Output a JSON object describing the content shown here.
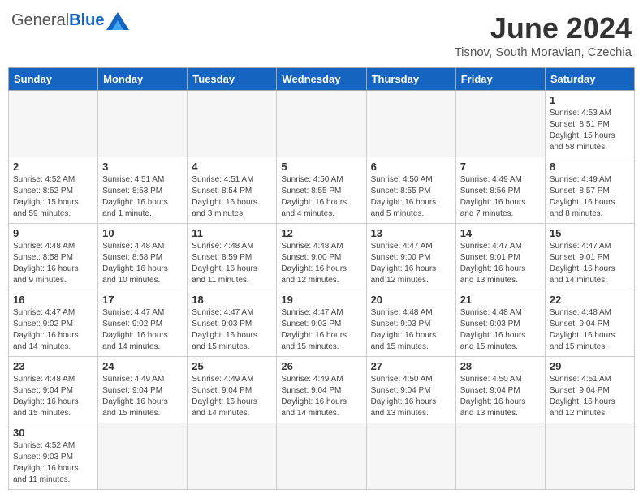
{
  "header": {
    "logo_general": "General",
    "logo_blue": "Blue",
    "month_title": "June 2024",
    "location": "Tisnov, South Moravian, Czechia"
  },
  "days_of_week": [
    "Sunday",
    "Monday",
    "Tuesday",
    "Wednesday",
    "Thursday",
    "Friday",
    "Saturday"
  ],
  "weeks": [
    [
      {
        "day": "",
        "info": ""
      },
      {
        "day": "",
        "info": ""
      },
      {
        "day": "",
        "info": ""
      },
      {
        "day": "",
        "info": ""
      },
      {
        "day": "",
        "info": ""
      },
      {
        "day": "",
        "info": ""
      },
      {
        "day": "1",
        "info": "Sunrise: 4:53 AM\nSunset: 8:51 PM\nDaylight: 15 hours\nand 58 minutes."
      }
    ],
    [
      {
        "day": "2",
        "info": "Sunrise: 4:52 AM\nSunset: 8:52 PM\nDaylight: 15 hours\nand 59 minutes."
      },
      {
        "day": "3",
        "info": "Sunrise: 4:51 AM\nSunset: 8:53 PM\nDaylight: 16 hours\nand 1 minute."
      },
      {
        "day": "4",
        "info": "Sunrise: 4:51 AM\nSunset: 8:54 PM\nDaylight: 16 hours\nand 3 minutes."
      },
      {
        "day": "5",
        "info": "Sunrise: 4:50 AM\nSunset: 8:55 PM\nDaylight: 16 hours\nand 4 minutes."
      },
      {
        "day": "6",
        "info": "Sunrise: 4:50 AM\nSunset: 8:55 PM\nDaylight: 16 hours\nand 5 minutes."
      },
      {
        "day": "7",
        "info": "Sunrise: 4:49 AM\nSunset: 8:56 PM\nDaylight: 16 hours\nand 7 minutes."
      },
      {
        "day": "8",
        "info": "Sunrise: 4:49 AM\nSunset: 8:57 PM\nDaylight: 16 hours\nand 8 minutes."
      }
    ],
    [
      {
        "day": "9",
        "info": "Sunrise: 4:48 AM\nSunset: 8:58 PM\nDaylight: 16 hours\nand 9 minutes."
      },
      {
        "day": "10",
        "info": "Sunrise: 4:48 AM\nSunset: 8:58 PM\nDaylight: 16 hours\nand 10 minutes."
      },
      {
        "day": "11",
        "info": "Sunrise: 4:48 AM\nSunset: 8:59 PM\nDaylight: 16 hours\nand 11 minutes."
      },
      {
        "day": "12",
        "info": "Sunrise: 4:48 AM\nSunset: 9:00 PM\nDaylight: 16 hours\nand 12 minutes."
      },
      {
        "day": "13",
        "info": "Sunrise: 4:47 AM\nSunset: 9:00 PM\nDaylight: 16 hours\nand 12 minutes."
      },
      {
        "day": "14",
        "info": "Sunrise: 4:47 AM\nSunset: 9:01 PM\nDaylight: 16 hours\nand 13 minutes."
      },
      {
        "day": "15",
        "info": "Sunrise: 4:47 AM\nSunset: 9:01 PM\nDaylight: 16 hours\nand 14 minutes."
      }
    ],
    [
      {
        "day": "16",
        "info": "Sunrise: 4:47 AM\nSunset: 9:02 PM\nDaylight: 16 hours\nand 14 minutes."
      },
      {
        "day": "17",
        "info": "Sunrise: 4:47 AM\nSunset: 9:02 PM\nDaylight: 16 hours\nand 14 minutes."
      },
      {
        "day": "18",
        "info": "Sunrise: 4:47 AM\nSunset: 9:03 PM\nDaylight: 16 hours\nand 15 minutes."
      },
      {
        "day": "19",
        "info": "Sunrise: 4:47 AM\nSunset: 9:03 PM\nDaylight: 16 hours\nand 15 minutes."
      },
      {
        "day": "20",
        "info": "Sunrise: 4:48 AM\nSunset: 9:03 PM\nDaylight: 16 hours\nand 15 minutes."
      },
      {
        "day": "21",
        "info": "Sunrise: 4:48 AM\nSunset: 9:03 PM\nDaylight: 16 hours\nand 15 minutes."
      },
      {
        "day": "22",
        "info": "Sunrise: 4:48 AM\nSunset: 9:04 PM\nDaylight: 16 hours\nand 15 minutes."
      }
    ],
    [
      {
        "day": "23",
        "info": "Sunrise: 4:48 AM\nSunset: 9:04 PM\nDaylight: 16 hours\nand 15 minutes."
      },
      {
        "day": "24",
        "info": "Sunrise: 4:49 AM\nSunset: 9:04 PM\nDaylight: 16 hours\nand 15 minutes."
      },
      {
        "day": "25",
        "info": "Sunrise: 4:49 AM\nSunset: 9:04 PM\nDaylight: 16 hours\nand 14 minutes."
      },
      {
        "day": "26",
        "info": "Sunrise: 4:49 AM\nSunset: 9:04 PM\nDaylight: 16 hours\nand 14 minutes."
      },
      {
        "day": "27",
        "info": "Sunrise: 4:50 AM\nSunset: 9:04 PM\nDaylight: 16 hours\nand 13 minutes."
      },
      {
        "day": "28",
        "info": "Sunrise: 4:50 AM\nSunset: 9:04 PM\nDaylight: 16 hours\nand 13 minutes."
      },
      {
        "day": "29",
        "info": "Sunrise: 4:51 AM\nSunset: 9:04 PM\nDaylight: 16 hours\nand 12 minutes."
      }
    ],
    [
      {
        "day": "30",
        "info": "Sunrise: 4:52 AM\nSunset: 9:03 PM\nDaylight: 16 hours\nand 11 minutes."
      },
      {
        "day": "",
        "info": ""
      },
      {
        "day": "",
        "info": ""
      },
      {
        "day": "",
        "info": ""
      },
      {
        "day": "",
        "info": ""
      },
      {
        "day": "",
        "info": ""
      },
      {
        "day": "",
        "info": ""
      }
    ]
  ]
}
